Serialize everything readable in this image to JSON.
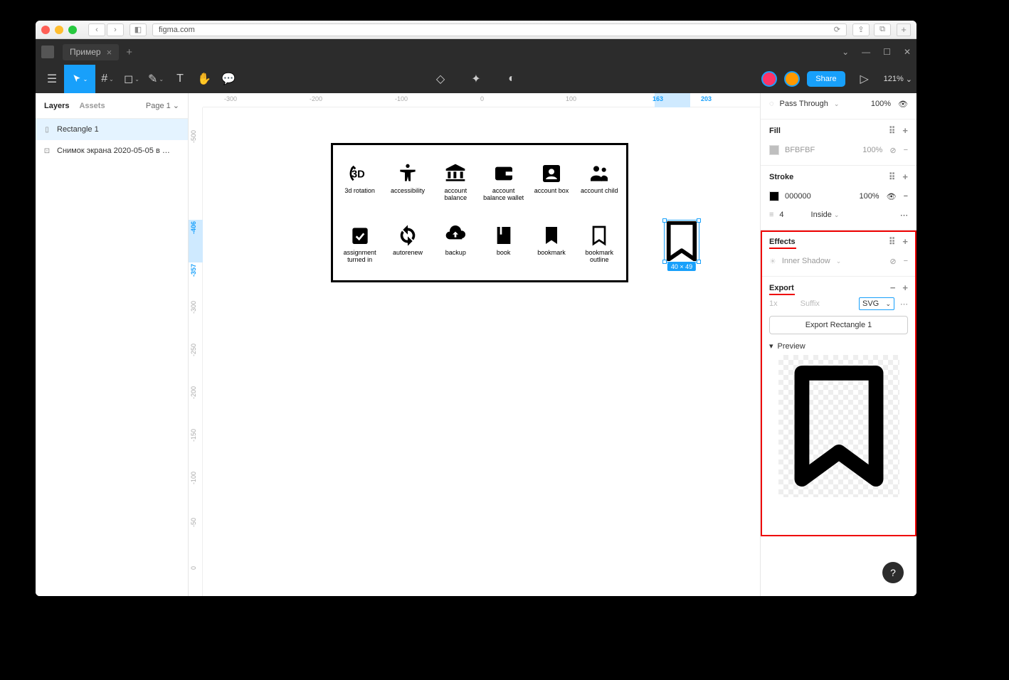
{
  "browser": {
    "url": "figma.com"
  },
  "figma": {
    "tab_title": "Пример",
    "zoom": "121%",
    "share_label": "Share"
  },
  "left_panel": {
    "tab_layers": "Layers",
    "tab_assets": "Assets",
    "pages_label": "Page 1",
    "layers": [
      {
        "name": "Rectangle 1",
        "selected": true
      },
      {
        "name": "Снимок экрана 2020-05-05 в 00....",
        "selected": false
      }
    ]
  },
  "ruler": {
    "top_ticks": [
      "-300",
      "-200",
      "-100",
      "0",
      "100",
      "163",
      "203"
    ],
    "left_ticks": [
      "-500",
      "-406",
      "-357",
      "-300",
      "-250",
      "-200",
      "-150",
      "-100",
      "-50",
      "0"
    ]
  },
  "selection": {
    "dim_label": "40 × 49"
  },
  "canvas_icons": {
    "row1": [
      "3d rotation",
      "accessibility",
      "account balance",
      "account balance wallet",
      "account box",
      "account child"
    ],
    "row2": [
      "assignment turned in",
      "autorenew",
      "backup",
      "book",
      "bookmark",
      "bookmark outline"
    ]
  },
  "right_panel": {
    "layer_section": {
      "mode": "Pass Through",
      "opacity": "100%"
    },
    "fill": {
      "title": "Fill",
      "hex": "BFBFBF",
      "opacity": "100%"
    },
    "stroke": {
      "title": "Stroke",
      "hex": "000000",
      "opacity": "100%",
      "weight": "4",
      "align": "Inside"
    },
    "effects": {
      "title": "Effects",
      "type": "Inner Shadow"
    },
    "export": {
      "title": "Export",
      "scale": "1x",
      "suffix": "Suffix",
      "format": "SVG",
      "button": "Export Rectangle 1",
      "preview_label": "Preview"
    }
  }
}
